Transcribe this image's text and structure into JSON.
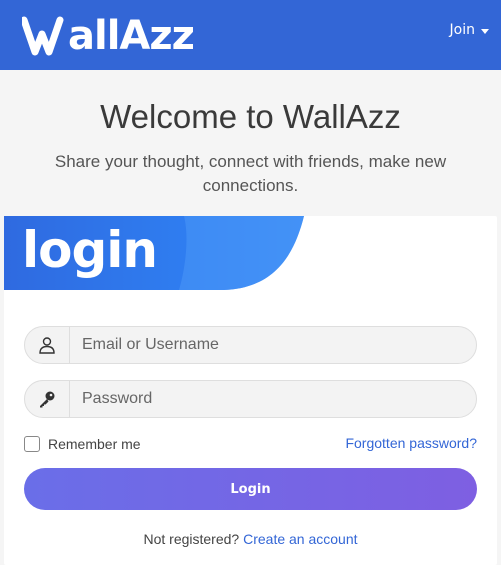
{
  "navbar": {
    "logo_text": "allAzz",
    "logo_letter": "W",
    "join_label": "Join",
    "bg_color": "#3366d6"
  },
  "hero": {
    "title": "Welcome to WallAzz",
    "subtitle": "Share your thought, connect with friends, make new connections."
  },
  "login_card": {
    "header_title": "login",
    "email_placeholder": "Email or Username",
    "password_placeholder": "Password",
    "email_icon": "user-icon",
    "password_icon": "key-icon",
    "remember_label": "Remember me",
    "remember_checked": false,
    "forgot_label": "Forgotten password?",
    "submit_label": "Login",
    "register_prompt": "Not registered?",
    "register_link": "Create an account",
    "accent_color": "#3366d6",
    "button_gradient": [
      "#6a6ee8",
      "#7e5fe2"
    ]
  }
}
